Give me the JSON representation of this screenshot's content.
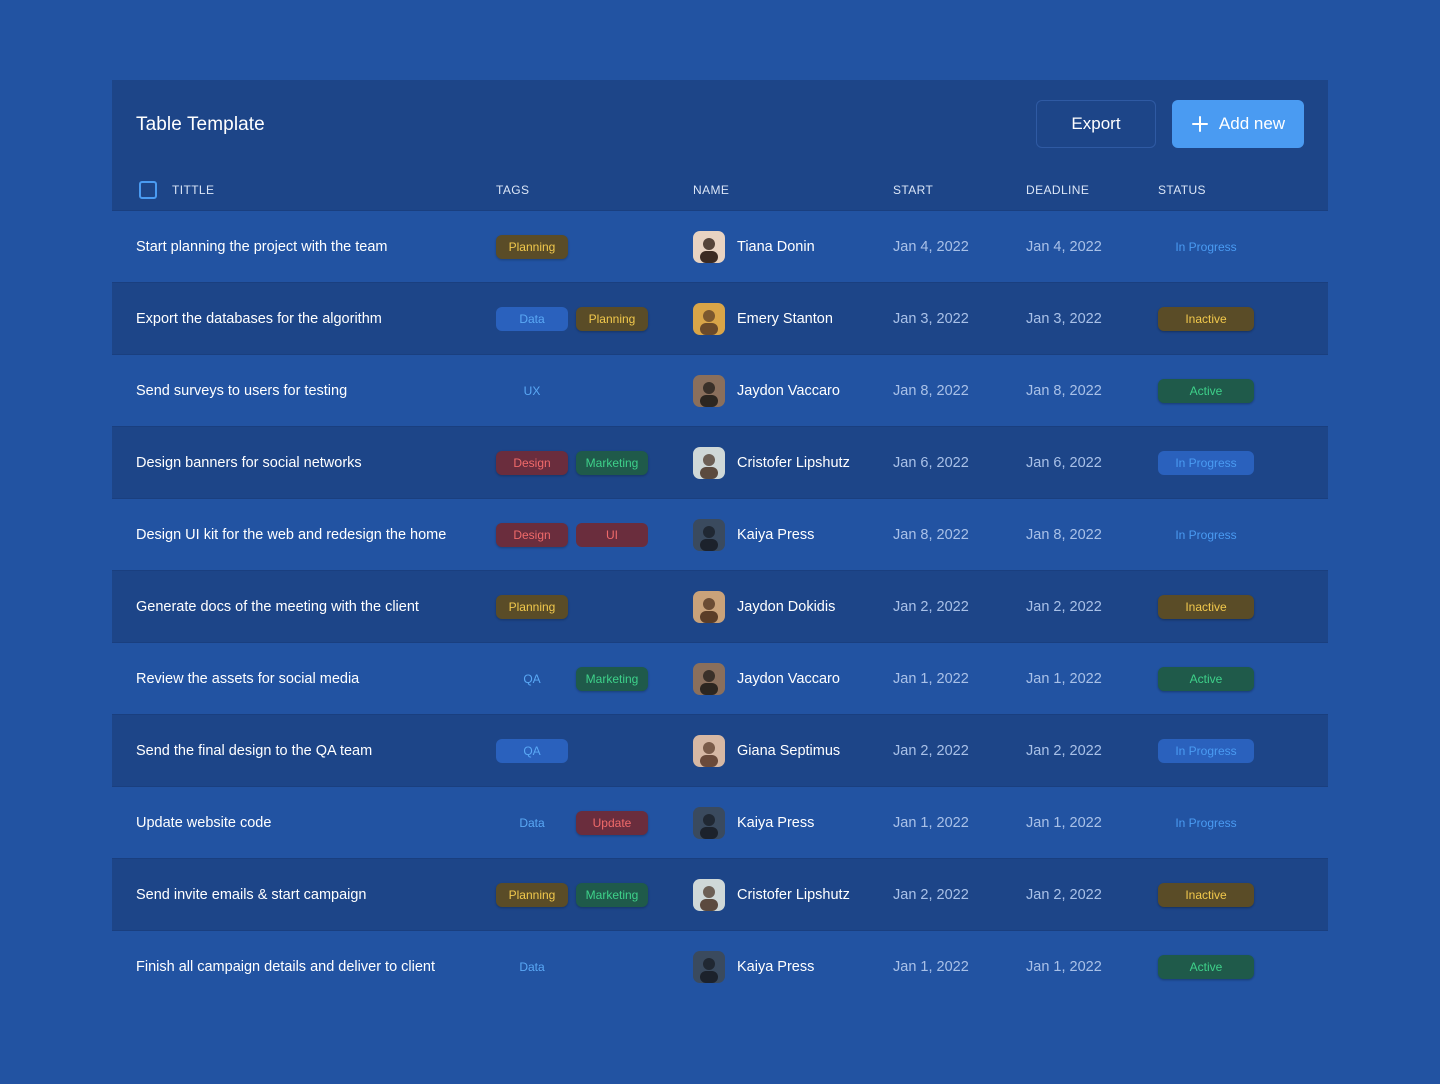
{
  "card": {
    "title": "Table Template",
    "export_label": "Export",
    "add_label": "Add new"
  },
  "columns": {
    "title": "TITTLE",
    "tags": "TAGS",
    "name": "NAME",
    "start": "START",
    "deadline": "DEADLINE",
    "status": "STATUS"
  },
  "colors": {
    "background": "#2253a2",
    "card_header": "#1d4588",
    "accent": "#4a9bf2",
    "planning": "#f2c94c",
    "design": "#f06a6a",
    "marketing": "#3ed18a",
    "data": "#5aa8f5"
  },
  "rows": [
    {
      "title": "Start planning the project with the team",
      "tags": [
        "Planning"
      ],
      "name": "Tiana Donin",
      "start": "Jan 4, 2022",
      "deadline": "Jan 4, 2022",
      "status": "In Progress"
    },
    {
      "title": "Export the databases for the algorithm",
      "tags": [
        "Data",
        "Planning"
      ],
      "name": "Emery Stanton",
      "start": "Jan 3, 2022",
      "deadline": "Jan 3, 2022",
      "status": "Inactive"
    },
    {
      "title": "Send surveys to users for testing",
      "tags": [
        "UX"
      ],
      "name": "Jaydon Vaccaro",
      "start": "Jan 8, 2022",
      "deadline": "Jan 8, 2022",
      "status": "Active"
    },
    {
      "title": "Design banners for social networks",
      "tags": [
        "Design",
        "Marketing"
      ],
      "name": "Cristofer Lipshutz",
      "start": "Jan 6, 2022",
      "deadline": "Jan 6, 2022",
      "status": "In Progress"
    },
    {
      "title": "Design UI kit for the web and redesign the home",
      "tags": [
        "Design",
        "UI"
      ],
      "name": "Kaiya Press",
      "start": "Jan 8, 2022",
      "deadline": "Jan 8, 2022",
      "status": "In Progress"
    },
    {
      "title": "Generate docs of the meeting with the client",
      "tags": [
        "Planning"
      ],
      "name": "Jaydon Dokidis",
      "start": "Jan 2, 2022",
      "deadline": "Jan 2, 2022",
      "status": "Inactive"
    },
    {
      "title": "Review the assets for social media",
      "tags": [
        "QA",
        "Marketing"
      ],
      "name": "Jaydon Vaccaro",
      "start": "Jan 1, 2022",
      "deadline": "Jan 1, 2022",
      "status": "Active"
    },
    {
      "title": "Send the final design to the QA team",
      "tags": [
        "QA"
      ],
      "name": "Giana Septimus",
      "start": "Jan 2, 2022",
      "deadline": "Jan 2, 2022",
      "status": "In Progress"
    },
    {
      "title": "Update website code",
      "tags": [
        "Data",
        "Update"
      ],
      "name": "Kaiya Press",
      "start": "Jan 1, 2022",
      "deadline": "Jan 1, 2022",
      "status": "In Progress"
    },
    {
      "title": "Send invite emails & start campaign",
      "tags": [
        "Planning",
        "Marketing"
      ],
      "name": "Cristofer Lipshutz",
      "start": "Jan 2, 2022",
      "deadline": "Jan 2, 2022",
      "status": "Inactive"
    },
    {
      "title": "Finish all campaign details and deliver to client",
      "tags": [
        "Data"
      ],
      "name": "Kaiya Press",
      "start": "Jan 1, 2022",
      "deadline": "Jan 1, 2022",
      "status": "Active"
    }
  ]
}
